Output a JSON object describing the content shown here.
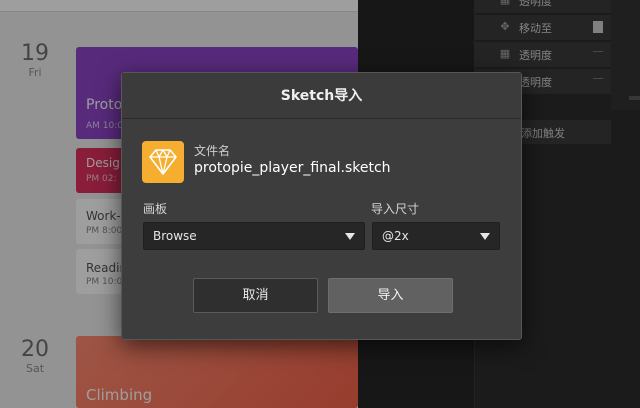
{
  "calendar": {
    "days": [
      {
        "num": "19",
        "dow": "Fri"
      },
      {
        "num": "20",
        "dow": "Sat"
      }
    ],
    "events": [
      {
        "title": "Proto",
        "sub": "AM 10:0"
      },
      {
        "title": "Design",
        "sub": "PM 02:"
      },
      {
        "title": "Work-",
        "sub": "PM 8:00"
      },
      {
        "title": "Readin",
        "sub": "PM 10:0"
      },
      {
        "title": "Climbing",
        "sub": ""
      }
    ]
  },
  "inspector": {
    "rows": [
      {
        "icon": "opacity-icon",
        "glyph": "▦",
        "label": "透明度"
      },
      {
        "icon": "move-icon",
        "glyph": "✥",
        "label": "移动至"
      },
      {
        "icon": "opacity-icon",
        "glyph": "▦",
        "label": "透明度"
      },
      {
        "icon": "opacity-icon",
        "glyph": "▦",
        "label": "透明度"
      }
    ],
    "add_trigger": "添加触发"
  },
  "dialog": {
    "title": "Sketch导入",
    "file_label": "文件名",
    "file_name": "protopie_player_final.sketch",
    "artboard_label": "画板",
    "artboard_value": "Browse",
    "size_label": "导入尺寸",
    "size_value": "@2x",
    "cancel_label": "取消",
    "import_label": "导入"
  },
  "colors": {
    "file_icon": "#f6ae31",
    "dialog_bg": "#3d3d3e",
    "event_purple": "#8e44c9",
    "event_red": "#dd2f5e",
    "event_orange": "#f4624a"
  }
}
